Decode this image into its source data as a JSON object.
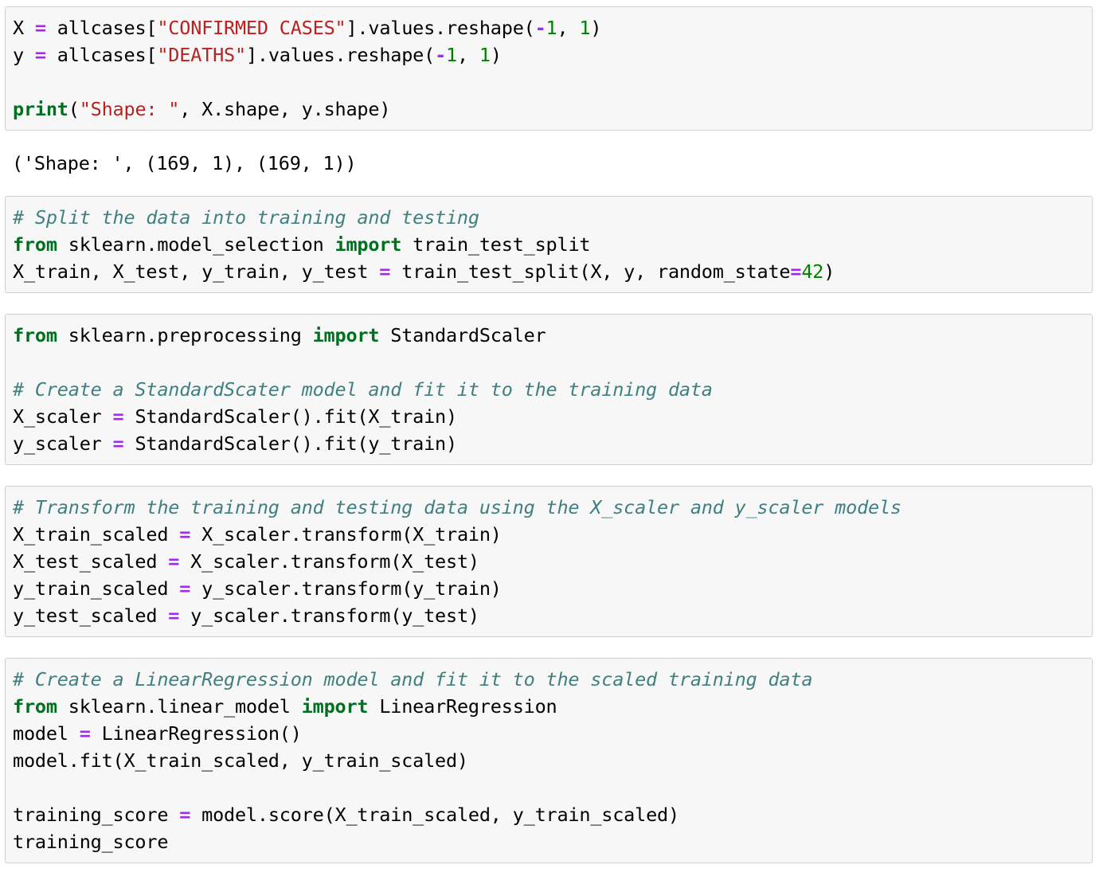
{
  "notebook": {
    "cells": [
      {
        "id": "cell-reshape",
        "type": "code",
        "lines": [
          [
            {
              "t": "X ",
              "c": "n"
            },
            {
              "t": "=",
              "c": "o"
            },
            {
              "t": " allcases[",
              "c": "n"
            },
            {
              "t": "\"CONFIRMED CASES\"",
              "c": "s"
            },
            {
              "t": "].values.reshape(",
              "c": "n"
            },
            {
              "t": "-",
              "c": "o"
            },
            {
              "t": "1",
              "c": "mi"
            },
            {
              "t": ", ",
              "c": "n"
            },
            {
              "t": "1",
              "c": "mi"
            },
            {
              "t": ")",
              "c": "n"
            }
          ],
          [
            {
              "t": "y ",
              "c": "n"
            },
            {
              "t": "=",
              "c": "o"
            },
            {
              "t": " allcases[",
              "c": "n"
            },
            {
              "t": "\"DEATHS\"",
              "c": "s"
            },
            {
              "t": "].values.reshape(",
              "c": "n"
            },
            {
              "t": "-",
              "c": "o"
            },
            {
              "t": "1",
              "c": "mi"
            },
            {
              "t": ", ",
              "c": "n"
            },
            {
              "t": "1",
              "c": "mi"
            },
            {
              "t": ")",
              "c": "n"
            }
          ],
          [],
          [
            {
              "t": "print",
              "c": "nb"
            },
            {
              "t": "(",
              "c": "n"
            },
            {
              "t": "\"Shape: \"",
              "c": "s"
            },
            {
              "t": ", X.shape, y.shape)",
              "c": "n"
            }
          ]
        ]
      },
      {
        "id": "output-shape",
        "type": "output",
        "text": "('Shape: ', (169, 1), (169, 1))"
      },
      {
        "id": "cell-train-test-split",
        "type": "code",
        "lines": [
          [
            {
              "t": "# Split the data into training and testing",
              "c": "c"
            }
          ],
          [
            {
              "t": "from",
              "c": "k"
            },
            {
              "t": " sklearn.model_selection ",
              "c": "n"
            },
            {
              "t": "import",
              "c": "k"
            },
            {
              "t": " train_test_split",
              "c": "n"
            }
          ],
          [
            {
              "t": "X_train, X_test, y_train, y_test ",
              "c": "n"
            },
            {
              "t": "=",
              "c": "o"
            },
            {
              "t": " train_test_split(X, y, random_state",
              "c": "n"
            },
            {
              "t": "=",
              "c": "o"
            },
            {
              "t": "42",
              "c": "mi"
            },
            {
              "t": ")",
              "c": "n"
            }
          ]
        ]
      },
      {
        "id": "cell-standard-scaler",
        "type": "code",
        "lines": [
          [
            {
              "t": "from",
              "c": "k"
            },
            {
              "t": " sklearn.preprocessing ",
              "c": "n"
            },
            {
              "t": "import",
              "c": "k"
            },
            {
              "t": " StandardScaler",
              "c": "n"
            }
          ],
          [],
          [
            {
              "t": "# Create a StandardScater model and fit it to the training data",
              "c": "c"
            }
          ],
          [
            {
              "t": "X_scaler ",
              "c": "n"
            },
            {
              "t": "=",
              "c": "o"
            },
            {
              "t": " StandardScaler().fit(X_train)",
              "c": "n"
            }
          ],
          [
            {
              "t": "y_scaler ",
              "c": "n"
            },
            {
              "t": "=",
              "c": "o"
            },
            {
              "t": " StandardScaler().fit(y_train)",
              "c": "n"
            }
          ]
        ]
      },
      {
        "id": "cell-transform",
        "type": "code",
        "lines": [
          [
            {
              "t": "# Transform the training and testing data using the X_scaler and y_scaler models",
              "c": "c"
            }
          ],
          [
            {
              "t": "X_train_scaled ",
              "c": "n"
            },
            {
              "t": "=",
              "c": "o"
            },
            {
              "t": " X_scaler.transform(X_train)",
              "c": "n"
            }
          ],
          [
            {
              "t": "X_test_scaled ",
              "c": "n"
            },
            {
              "t": "=",
              "c": "o"
            },
            {
              "t": " X_scaler.transform(X_test)",
              "c": "n"
            }
          ],
          [
            {
              "t": "y_train_scaled ",
              "c": "n"
            },
            {
              "t": "=",
              "c": "o"
            },
            {
              "t": " y_scaler.transform(y_train)",
              "c": "n"
            }
          ],
          [
            {
              "t": "y_test_scaled ",
              "c": "n"
            },
            {
              "t": "=",
              "c": "o"
            },
            {
              "t": " y_scaler.transform(y_test)",
              "c": "n"
            }
          ]
        ]
      },
      {
        "id": "cell-linear-regression",
        "type": "code",
        "lines": [
          [
            {
              "t": "# Create a LinearRegression model and fit it to the scaled training data",
              "c": "c"
            }
          ],
          [
            {
              "t": "from",
              "c": "k"
            },
            {
              "t": " sklearn.linear_model ",
              "c": "n"
            },
            {
              "t": "import",
              "c": "k"
            },
            {
              "t": " LinearRegression",
              "c": "n"
            }
          ],
          [
            {
              "t": "model ",
              "c": "n"
            },
            {
              "t": "=",
              "c": "o"
            },
            {
              "t": " LinearRegression()",
              "c": "n"
            }
          ],
          [
            {
              "t": "model.fit(X_train_scaled, y_train_scaled)",
              "c": "n"
            }
          ],
          [],
          [
            {
              "t": "training_score ",
              "c": "n"
            },
            {
              "t": "=",
              "c": "o"
            },
            {
              "t": " model.score(X_train_scaled, y_train_scaled)",
              "c": "n"
            }
          ],
          [
            {
              "t": "training_score",
              "c": "n"
            }
          ]
        ]
      }
    ]
  },
  "theme": {
    "cell_background": "#f7f7f7",
    "cell_border": "#cfcfcf",
    "output_background": "#ffffff",
    "text": "#000000",
    "comment": "#408080",
    "keyword": "#007020",
    "string": "#BA2121",
    "operator": "#AA22FF",
    "number": "#008000"
  }
}
